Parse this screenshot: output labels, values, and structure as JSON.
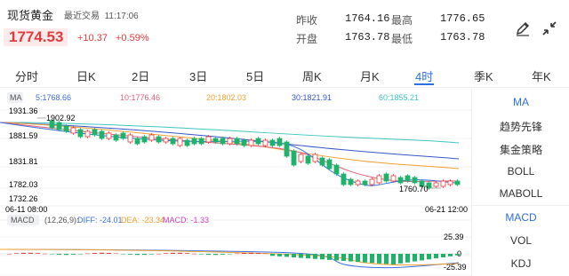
{
  "header": {
    "title": "现货黄金",
    "market_status": "最近交易",
    "time": "11:17:06",
    "price": "1774.53",
    "change": "+10.37",
    "change_pct": "+0.59%"
  },
  "stats": {
    "prev_close_label": "昨收",
    "prev_close": "1764.16",
    "high_label": "最高",
    "high": "1776.65",
    "open_label": "开盘",
    "open": "1763.78",
    "low_label": "最低",
    "low": "1763.78"
  },
  "tabs": [
    "分时",
    "日K",
    "2日",
    "3日",
    "5日",
    "周K",
    "月K",
    "4时",
    "季K",
    "年K"
  ],
  "active_tab": "4时",
  "ma_legend": {
    "label": "MA",
    "ma5": "5:1768.66",
    "ma10": "10:1776.46",
    "ma20": "20:1802.03",
    "ma30": "30:1821.91",
    "ma60": "60:1855.21"
  },
  "price_axis": [
    "1931.36",
    "1881.59",
    "1831.81",
    "1782.03",
    "1732.26"
  ],
  "annotations": {
    "max_marker": "1902.92",
    "min_marker": "1760.70"
  },
  "time_axis": {
    "start": "06-11 08:00",
    "end": "06-21 12:00"
  },
  "macd_legend": {
    "label": "MACD",
    "params": "(12,26,9):",
    "diff": "DIFF: -24.01",
    "dea": "DEA: -23.34",
    "macd": "MACD: -1.33"
  },
  "macd_axis": {
    "top": "25.39",
    "mid": "0",
    "bottom": "-25.39"
  },
  "indicator_panel": [
    "MA",
    "趋势先锋",
    "集金策略",
    "BOLL",
    "MABOLL",
    "MACD",
    "VOL",
    "KDJ"
  ],
  "colors": {
    "up": "#e13c3c",
    "down": "#1fb36a",
    "accent": "#2f6fe0",
    "ma5": "#3a6fe0",
    "ma10": "#e0607a",
    "ma20": "#f0a030",
    "ma30": "#3556c9",
    "ma60": "#3ec5c0"
  }
}
